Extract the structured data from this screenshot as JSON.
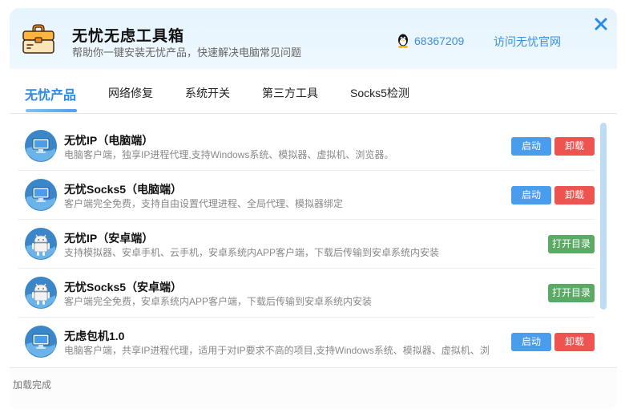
{
  "header": {
    "title": "无忧无虑工具箱",
    "subtitle": "帮助你一键安装无忧产品，快速解决电脑常见问题",
    "qq_number": "68367209",
    "visit_link": "访问无忧官网",
    "icons": {
      "app": "toolbox-icon",
      "qq": "qq-penguin-icon",
      "close": "close-icon"
    }
  },
  "tabs": [
    {
      "label": "无忧产品",
      "active": true
    },
    {
      "label": "网络修复",
      "active": false
    },
    {
      "label": "系统开关",
      "active": false
    },
    {
      "label": "第三方工具",
      "active": false
    },
    {
      "label": "Socks5检测",
      "active": false
    }
  ],
  "products": [
    {
      "title": "无忧IP（电脑端）",
      "description": "电脑客户端，独享IP进程代理,支持Windows系统、模拟器、虚拟机、浏览器。",
      "icon": "monitor-icon",
      "buttons": [
        "启动",
        "卸载"
      ]
    },
    {
      "title": "无忧Socks5（电脑端）",
      "description": "客户端完全免费，支持自由设置代理进程、全局代理、模拟器绑定",
      "icon": "monitor-icon",
      "buttons": [
        "启动",
        "卸载"
      ]
    },
    {
      "title": "无忧IP（安卓端）",
      "description": "支持模拟器、安卓手机、云手机，安卓系统内APP客户端，下载后传输到安卓系统内安装",
      "icon": "android-icon",
      "buttons": [
        "打开目录"
      ]
    },
    {
      "title": "无忧Socks5（安卓端）",
      "description": "客户端完全免费，安卓系统内APP客户端，下载后传输到安卓系统内安装",
      "icon": "android-icon",
      "buttons": [
        "打开目录"
      ]
    },
    {
      "title": "无虑包机1.0",
      "description": "电脑客户端，共享IP进程代理，适用于对IP要求不高的项目,支持Windows系统、模拟器、虚拟机、浏",
      "icon": "monitor-icon",
      "buttons": [
        "启动",
        "卸载"
      ]
    }
  ],
  "status": {
    "text": "加载完成"
  },
  "colors": {
    "accent": "#2c8ae8",
    "start_button": "#4a9cec",
    "uninstall_button": "#ef5350",
    "open_button": "#5aaa64"
  }
}
